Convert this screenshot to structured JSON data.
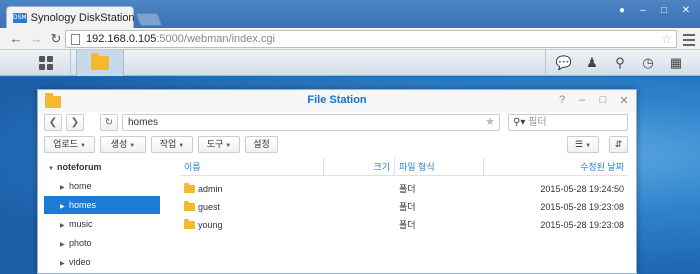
{
  "browser": {
    "tab_favicon": "DSM",
    "tab_title": "Synology DiskStation",
    "tab_close": "×",
    "url_host": "192.168.0.105",
    "url_path": ":5000/webman/index.cgi"
  },
  "file_station": {
    "title": "File Station",
    "path_value": "homes",
    "search_placeholder": "필터",
    "toolbar": {
      "upload": "업로드",
      "create": "생성",
      "action": "작업",
      "tools": "도구",
      "settings": "설정"
    },
    "tree": {
      "root": "noteforum",
      "items": [
        {
          "label": "home",
          "selected": false
        },
        {
          "label": "homes",
          "selected": true
        },
        {
          "label": "music",
          "selected": false
        },
        {
          "label": "photo",
          "selected": false
        },
        {
          "label": "video",
          "selected": false
        }
      ]
    },
    "columns": {
      "name": "이름",
      "size": "크기",
      "type": "파일 형식",
      "modified": "수정된 날짜"
    },
    "rows": [
      {
        "name": "admin",
        "size": "",
        "type": "폴더",
        "modified": "2015-05-28 19:24:50"
      },
      {
        "name": "guest",
        "size": "",
        "type": "폴더",
        "modified": "2015-05-28 19:23:08"
      },
      {
        "name": "young",
        "size": "",
        "type": "폴더",
        "modified": "2015-05-28 19:23:08"
      }
    ]
  },
  "colors": {
    "accent": "#1b7bd5",
    "folder": "#f5b82e",
    "desktop": "#2e83cc"
  }
}
